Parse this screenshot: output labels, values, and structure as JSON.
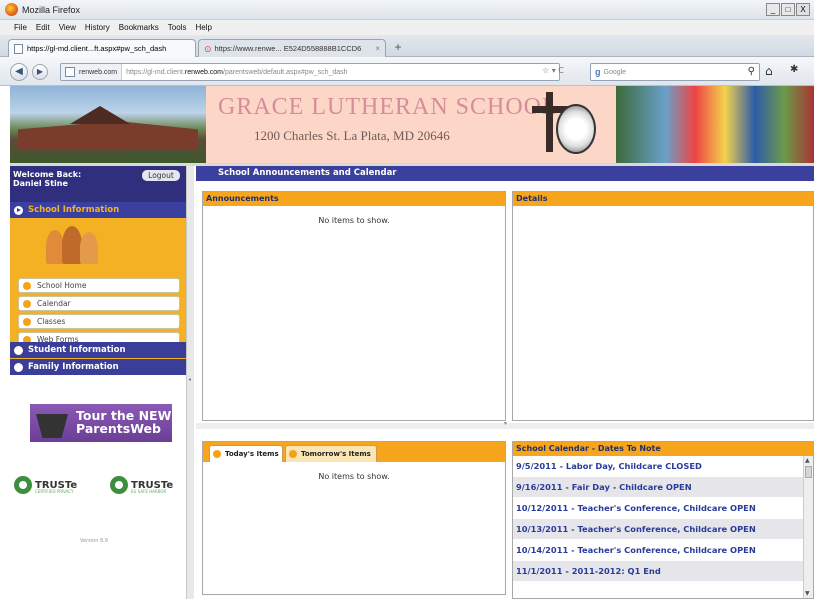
{
  "window": {
    "title": "Mozilla Firefox",
    "controls": [
      "_",
      "□",
      "X"
    ]
  },
  "menu": [
    "File",
    "Edit",
    "View",
    "History",
    "Bookmarks",
    "Tools",
    "Help"
  ],
  "tabs": [
    {
      "label": "https://gl-md.client...ft.aspx#pw_sch_dash",
      "active": true,
      "close": ""
    },
    {
      "label": "https://www.renwe... E524D558888B1CCD6",
      "active": false,
      "close": "×"
    }
  ],
  "newtab_label": "+",
  "nav": {
    "back": "◀",
    "forward": "▶",
    "site": "renweb.com",
    "url_prefix": "https://gl-md.client.",
    "url_domain": "renweb.com",
    "url_path": "/parentsweb/default.aspx#pw_sch_dash",
    "url_ctrl": "☆ ▾ C",
    "search_engine": "Google",
    "search_icon_glyph": "g",
    "search_mag": "⚲",
    "home": "⌂",
    "bookmarks": "✱"
  },
  "banner": {
    "title": "GRACE LUTHERAN SCHOOL",
    "address": "1200 Charles St. La Plata, MD 20646"
  },
  "sidebar": {
    "welcome_label": "Welcome Back:",
    "user_name": "Daniel Stine",
    "logout_label": "Logout",
    "school_section": "School Information",
    "school_items": [
      "School Home",
      "Calendar",
      "Classes",
      "Web Forms"
    ],
    "student_section": "Student Information",
    "family_section": "Family Information",
    "tour_line1": "Tour the NEW",
    "tour_line2": "ParentsWeb",
    "truste1": "TRUSTe",
    "truste1_sub": "CERTIFIED PRIVACY",
    "truste2": "TRUSTe",
    "truste2_sub": "EU SAFE HARBOR",
    "version": "Version 8.9"
  },
  "main": {
    "header": "School Announcements and Calendar",
    "announcements_title": "Announcements",
    "announcements_empty": "No items to show.",
    "details_title": "Details",
    "today_tab": "Today's Items",
    "tomorrow_tab": "Tomorrow's Items",
    "items_empty": "No items to show.",
    "calendar_title": "School Calendar - Dates To Note",
    "calendar_items": [
      "9/5/2011 - Labor Day, Childcare CLOSED",
      "9/16/2011 - Fair Day - Childcare OPEN",
      "10/12/2011 - Teacher's Conference, Childcare OPEN",
      "10/13/2011 - Teacher's Conference, Childcare OPEN",
      "10/14/2011 - Teacher's Conference, Childcare OPEN",
      "11/1/2011 - 2011-2012: Q1 End"
    ]
  },
  "colors": {
    "header_blue": "#3b3f9e",
    "accent_orange": "#f7a51c",
    "link_blue": "#2a3c9a",
    "banner_pink": "#fcd6c6"
  }
}
